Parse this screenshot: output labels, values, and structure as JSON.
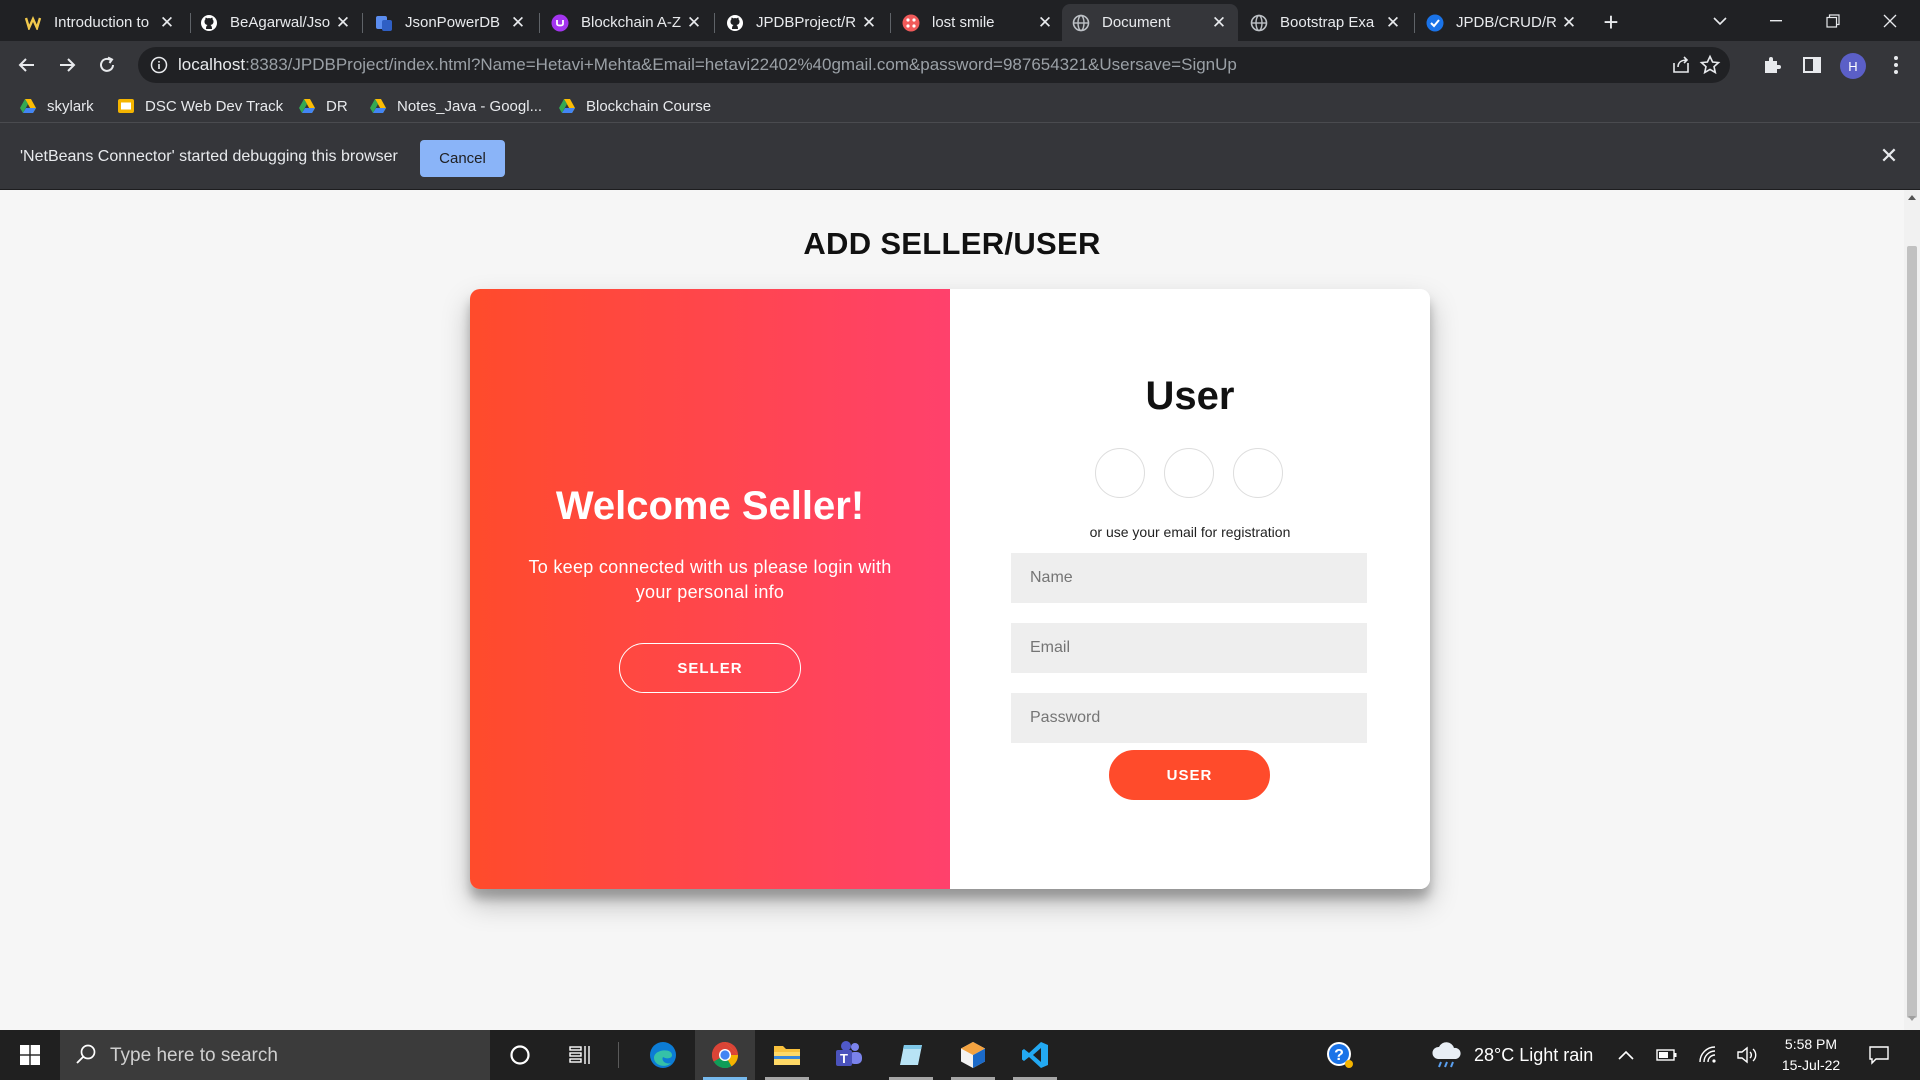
{
  "browser": {
    "tabs": [
      {
        "title": "Introduction to",
        "favicon": "medium-icon",
        "active": false
      },
      {
        "title": "BeAgarwal/Jso",
        "favicon": "github-icon",
        "active": false
      },
      {
        "title": "JsonPowerDB",
        "favicon": "jpdb-icon",
        "active": false
      },
      {
        "title": "Blockchain A-Z",
        "favicon": "udemy-icon",
        "active": false
      },
      {
        "title": "JPDBProject/R",
        "favicon": "github-icon",
        "active": false
      },
      {
        "title": "lost smile",
        "favicon": "app-icon",
        "active": false
      },
      {
        "title": "Document",
        "favicon": "globe-icon",
        "active": true
      },
      {
        "title": "Bootstrap Exa",
        "favicon": "globe-icon",
        "active": false
      },
      {
        "title": "JPDB/CRUD/R",
        "favicon": "check-icon",
        "active": false
      }
    ],
    "url_host": "localhost",
    "url_rest": ":8383/JPDBProject/index.html?Name=Hetavi+Mehta&Email=hetavi22402%40gmail.com&password=987654321&Usersave=SignUp",
    "profile_initial": "H",
    "bookmarks": [
      {
        "label": "skylark",
        "icon": "drive-icon"
      },
      {
        "label": "DSC Web Dev Track",
        "icon": "slides-icon"
      },
      {
        "label": "DR",
        "icon": "drive-icon"
      },
      {
        "label": "Notes_Java - Googl...",
        "icon": "drive-icon"
      },
      {
        "label": "Blockchain Course",
        "icon": "drive-icon"
      }
    ],
    "infobar": {
      "message": "'NetBeans Connector' started debugging this browser",
      "cancel_label": "Cancel"
    }
  },
  "page": {
    "heading": "ADD SELLER/USER",
    "overlay": {
      "title": "Welcome Seller!",
      "text": "To keep connected with us please login with your personal info",
      "button_label": "SELLER"
    },
    "form": {
      "title": "User",
      "hint": "or use your email for registration",
      "name_placeholder": "Name",
      "email_placeholder": "Email",
      "password_placeholder": "Password",
      "submit_label": "USER"
    }
  },
  "taskbar": {
    "search_placeholder": "Type here to search",
    "weather": "28°C  Light rain",
    "time": "5:58 PM",
    "date": "15-Jul-22"
  },
  "colors": {
    "gradient_start": "#ff4b2b",
    "gradient_end": "#ff416c",
    "accent_button": "#ff4b2b",
    "infobar_button": "#8ab4f8"
  }
}
